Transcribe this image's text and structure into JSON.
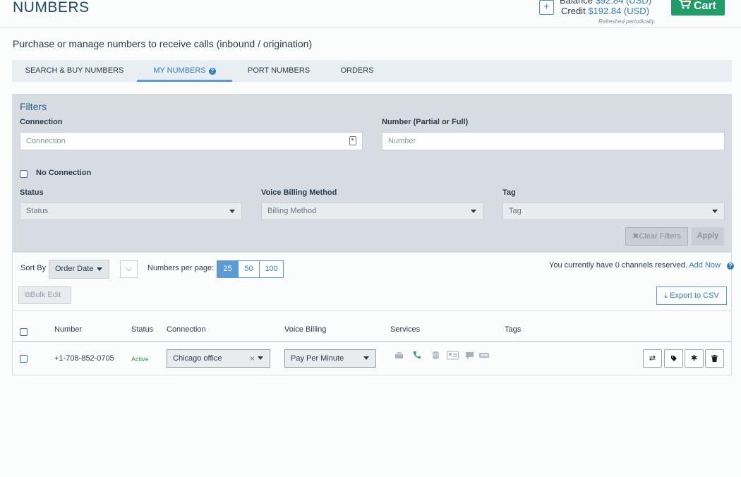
{
  "header": {
    "title": "NUMBERS",
    "add_funds_icon": "plus",
    "balance_label": "Balance",
    "balance_value": "$92.84 (USD)",
    "credit_label": "Credit",
    "credit_value": "$192.84 (USD)",
    "refreshed_note": "Refreshed periodically.",
    "cart_label": "Cart"
  },
  "subtitle": "Purchase or manage numbers to receive calls (inbound / origination)",
  "tabs": [
    {
      "label": "SEARCH & BUY NUMBERS",
      "active": false
    },
    {
      "label": "MY NUMBERS",
      "active": true
    },
    {
      "label": "PORT NUMBERS",
      "active": false
    },
    {
      "label": "ORDERS",
      "active": false
    }
  ],
  "filters": {
    "title": "Filters",
    "connection_label": "Connection",
    "connection_placeholder": "Connection",
    "number_label": "Number (Partial or Full)",
    "number_placeholder": "Number",
    "no_connection_label": "No Connection",
    "status_label": "Status",
    "status_value": "Status",
    "billing_label": "Voice Billing Method",
    "billing_value": "Billing Method",
    "tag_label": "Tag",
    "tag_value": "Tag",
    "clear_label": "Clear Filters",
    "apply_label": "Apply"
  },
  "list": {
    "sort_by_label": "Sort By",
    "sort_value": "Order Date",
    "per_page_label": "Numbers per page:",
    "per_page_options": [
      "25",
      "50",
      "100"
    ],
    "per_page_selected": "25",
    "channels_text": "You currently have 0 channels reserved.",
    "add_now_label": "Add Now",
    "bulk_edit_label": "Bulk Edit",
    "export_label": "Export to CSV",
    "columns": [
      "Number",
      "Status",
      "Connection",
      "Voice Billing",
      "Services",
      "Tags"
    ],
    "rows": [
      {
        "number": "+1-708-852-0705",
        "status": "Active",
        "connection": "Chicago office",
        "voice_billing": "Pay Per Minute",
        "services": [
          "fax-icon",
          "phone-icon",
          "database-icon",
          "cnam-icon",
          "sms-icon",
          "e911-icon"
        ],
        "tags": ""
      }
    ]
  },
  "colors": {
    "accent": "#2e7bc0",
    "cart_green": "#1f9c68",
    "active_green": "#3a9b55",
    "filters_bg": "#d6dce1"
  }
}
